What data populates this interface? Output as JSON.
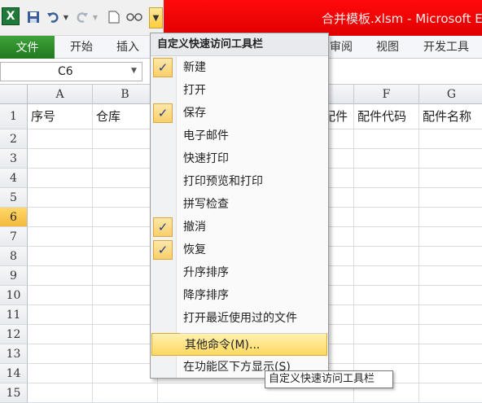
{
  "titlebar": {
    "title": "合并模板.xlsm - Microsoft E",
    "accent": "#ff0000"
  },
  "qat": {
    "app_icon": "excel-icon",
    "buttons": [
      "save-icon",
      "undo-icon",
      "redo-icon",
      "new-doc-icon",
      "glasses-icon"
    ],
    "dropdown_icon": "chevron-down-icon"
  },
  "ribbon": {
    "file_label": "文件",
    "tabs": [
      "开始",
      "插入",
      "审阅",
      "视图",
      "开发工具"
    ],
    "file_color": "#2e8b2e"
  },
  "formula_bar": {
    "name_box": "C6"
  },
  "sheet": {
    "columns": [
      "A",
      "B",
      "F",
      "G"
    ],
    "rows": [
      "1",
      "2",
      "3",
      "4",
      "5",
      "6",
      "7",
      "8",
      "9",
      "10",
      "11",
      "12",
      "13",
      "14",
      "15"
    ],
    "active_row": "6",
    "row1": {
      "A": "序号",
      "B": "仓库",
      "E_partial": "配件",
      "F": "配件代码",
      "G": "配件名称"
    }
  },
  "menu": {
    "header": "自定义快速访问工具栏",
    "items": [
      {
        "label": "新建",
        "checked": true
      },
      {
        "label": "打开",
        "checked": false
      },
      {
        "label": "保存",
        "checked": true
      },
      {
        "label": "电子邮件",
        "checked": false
      },
      {
        "label": "快速打印",
        "checked": false
      },
      {
        "label": "打印预览和打印",
        "checked": false
      },
      {
        "label": "拼写检查",
        "checked": false
      },
      {
        "label": "撤消",
        "checked": true
      },
      {
        "label": "恢复",
        "checked": true
      },
      {
        "label": "升序排序",
        "checked": false
      },
      {
        "label": "降序排序",
        "checked": false
      },
      {
        "label": "打开最近使用过的文件",
        "checked": false
      },
      {
        "label": "其他命令(M)...",
        "checked": false
      },
      {
        "label": "在功能区下方显示(S)",
        "checked": false
      }
    ],
    "check_icon": "checkmark-icon"
  },
  "tooltip": {
    "text": "自定义快速访问工具栏"
  }
}
